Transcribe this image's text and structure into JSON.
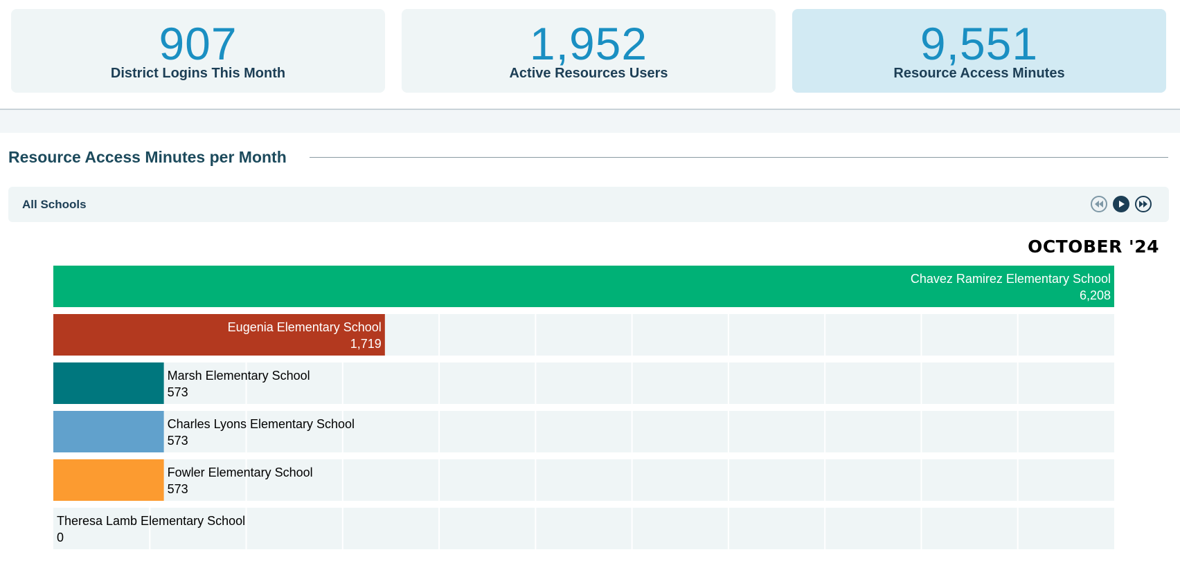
{
  "stats": [
    {
      "value": "907",
      "label": "District Logins This Month"
    },
    {
      "value": "1,952",
      "label": "Active Resources Users"
    },
    {
      "value": "9,551",
      "label": "Resource Access Minutes"
    }
  ],
  "section": {
    "title": "Resource Access Minutes per Month"
  },
  "filter": {
    "label": "All Schools"
  },
  "controls": {
    "rewind_icon": "rewind-icon",
    "play_icon": "play-icon",
    "forward_icon": "fast-forward-icon"
  },
  "colors": {
    "accent": "#1a8fc2",
    "dark": "#1c3e55"
  },
  "chart_data": {
    "type": "bar",
    "orientation": "horizontal",
    "period": "OCTOBER '24",
    "xlim": [
      0,
      5500
    ],
    "categories": [
      "Chavez Ramirez Elementary School",
      "Eugenia Elementary School",
      "Marsh Elementary School",
      "Charles Lyons Elementary School",
      "Fowler Elementary School",
      "Theresa Lamb Elementary School"
    ],
    "values": [
      6208,
      1719,
      573,
      573,
      573,
      0
    ],
    "value_labels": [
      "6,208",
      "1,719",
      "573",
      "573",
      "573",
      "0"
    ],
    "colors": [
      "#00b176",
      "#b3391f",
      "#00777e",
      "#61a1cc",
      "#fc9b30",
      "#9aa5aa"
    ],
    "grid": true
  }
}
